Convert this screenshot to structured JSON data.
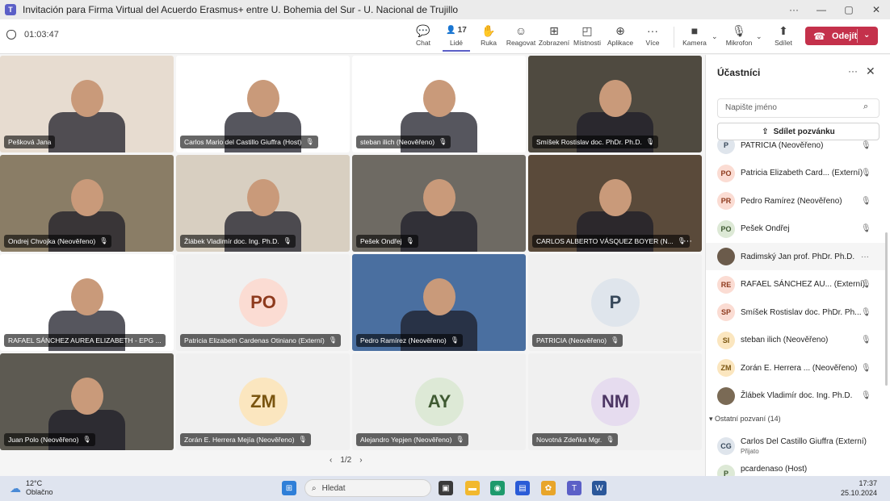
{
  "window": {
    "title": "Invitación para Firma Virtual del Acuerdo Erasmus+ entre U. Bohemia del Sur - U. Nacional de Trujillo",
    "app_icon": "T",
    "controls": [
      "···",
      "—",
      "▢",
      "✕"
    ]
  },
  "toolbar": {
    "timer": "01:03:47",
    "buttons": [
      {
        "label": "Chat",
        "icon": "chat-icon"
      },
      {
        "label": "Lidé",
        "icon": "people-icon",
        "count": "17"
      },
      {
        "label": "Ruka",
        "icon": "hand-icon"
      },
      {
        "label": "Reagovat",
        "icon": "emoji-icon"
      },
      {
        "label": "Zobrazení",
        "icon": "grid-icon"
      },
      {
        "label": "Místnosti",
        "icon": "rooms-icon"
      },
      {
        "label": "Aplikace",
        "icon": "plus-icon"
      },
      {
        "label": "Více",
        "icon": "more-icon"
      },
      {
        "label": "Kamera",
        "icon": "camera-icon"
      },
      {
        "label": "Mikrofon",
        "icon": "mic-icon"
      },
      {
        "label": "Sdílet",
        "icon": "share-icon"
      }
    ],
    "leave_label": "Odejít"
  },
  "tiles": [
    {
      "name": "Pešková Jana",
      "kind": "video",
      "bg": "#e7dcd0",
      "mic": false
    },
    {
      "name": "Carlos Mario del Castillo Giuffra (Host)",
      "kind": "video",
      "bg": "#ffffff",
      "mic": true
    },
    {
      "name": "steban ilich (Neověřeno)",
      "kind": "video",
      "bg": "#ffffff",
      "mic": true
    },
    {
      "name": "Smíšek Rostislav doc. PhDr. Ph.D.",
      "kind": "video",
      "bg": "#4f4a40",
      "mic": true
    },
    {
      "name": "Ondrej Chvojka (Neověřeno)",
      "kind": "video",
      "bg": "#8a7d66",
      "mic": true
    },
    {
      "name": "Žlábek Vladimír doc. Ing. Ph.D.",
      "kind": "video",
      "bg": "#d8cfc1",
      "mic": true
    },
    {
      "name": "Pešek Ondřej",
      "kind": "video",
      "bg": "#6e6a63",
      "mic": true
    },
    {
      "name": "CARLOS ALBERTO VÁSQUEZ BOYER (N...",
      "kind": "video",
      "bg": "#5a4a3a",
      "mic": true,
      "more": true
    },
    {
      "name": "RAFAEL SÁNCHEZ AUREA ELIZABETH - EPG ...",
      "kind": "video",
      "bg": "#ffffff",
      "mic": true
    },
    {
      "name": "Patricia Elizabeth Cardenas Otiniano (Externí)",
      "kind": "avatar",
      "initials": "PO",
      "av_bg": "#fbdcd3",
      "av_fg": "#8e3a1d",
      "mic": true
    },
    {
      "name": "Pedro Ramírez (Neověřeno)",
      "kind": "video",
      "bg": "#4a6fa0",
      "mic": true
    },
    {
      "name": "PATRICIA (Neověřeno)",
      "kind": "avatar",
      "initials": "P",
      "av_bg": "#dfe5ec",
      "av_fg": "#37485a",
      "mic": true
    },
    {
      "name": "Juan Polo (Neověřeno)",
      "kind": "video",
      "bg": "#5d5a52",
      "mic": true
    },
    {
      "name": "Zorán E. Herrera Mejía (Neověřeno)",
      "kind": "avatar",
      "initials": "ZM",
      "av_bg": "#fbe6bf",
      "av_fg": "#7a5510",
      "mic": true
    },
    {
      "name": "Alejandro Yepjen (Neověřeno)",
      "kind": "avatar",
      "initials": "AY",
      "av_bg": "#dde9d6",
      "av_fg": "#3f5a32",
      "mic": true
    },
    {
      "name": "Novotná Zdeňka Mgr.",
      "kind": "avatar",
      "initials": "NM",
      "av_bg": "#e6dcef",
      "av_fg": "#4d3664",
      "mic": true
    }
  ],
  "pager": {
    "prev": "‹",
    "label": "1/2",
    "next": "›"
  },
  "panel": {
    "title": "Účastníci",
    "search_placeholder": "Napište jméno",
    "share_label": "Sdílet pozvánku",
    "participants": [
      {
        "name": "PATRICIA (Neověřeno)",
        "initials": "P",
        "av_bg": "#dfe5ec",
        "av_fg": "#37485a",
        "status": "mute"
      },
      {
        "name": "Patricia Elizabeth Card... (Externí)",
        "initials": "PO",
        "av_bg": "#fbdcd3",
        "av_fg": "#8e3a1d",
        "status": "mute"
      },
      {
        "name": "Pedro Ramírez (Neověřeno)",
        "initials": "PR",
        "av_bg": "#fbdcd3",
        "av_fg": "#8e3a1d",
        "status": "mute"
      },
      {
        "name": "Pešek Ondřej",
        "initials": "PO",
        "av_bg": "#dde9d6",
        "av_fg": "#3f5a32",
        "status": "mute"
      },
      {
        "name": "Radimský Jan prof. PhDr. Ph.D.",
        "initials": "",
        "av_bg": "#6b5b4b",
        "av_fg": "#ffffff",
        "status": "more"
      },
      {
        "name": "RAFAEL SÁNCHEZ AU... (Externí)",
        "initials": "RE",
        "av_bg": "#fbdcd3",
        "av_fg": "#8e3a1d",
        "status": "mute"
      },
      {
        "name": "Smíšek Rostislav doc. PhDr. Ph...",
        "initials": "SP",
        "av_bg": "#fbdcd3",
        "av_fg": "#8e3a1d",
        "status": "mute"
      },
      {
        "name": "steban ilich (Neověřeno)",
        "initials": "SI",
        "av_bg": "#fbe6bf",
        "av_fg": "#7a5510",
        "status": "mute"
      },
      {
        "name": "Zorán E. Herrera ... (Neověřeno)",
        "initials": "ZM",
        "av_bg": "#fbe6bf",
        "av_fg": "#7a5510",
        "status": "mute"
      },
      {
        "name": "Žlábek Vladimír doc. Ing. Ph.D.",
        "initials": "",
        "av_bg": "#7a6a55",
        "av_fg": "#ffffff",
        "status": "mute"
      }
    ],
    "invited_section": "Ostatní pozvaní (14)",
    "invited": [
      {
        "name": "Carlos Del Castillo Giuffra (Externí)",
        "sub": "Přijato",
        "initials": "CG",
        "av_bg": "#dfe5ec",
        "av_fg": "#37485a"
      },
      {
        "name": "pcardenaso (Host)",
        "sub": "",
        "initials": "P",
        "av_bg": "#dde9d6",
        "av_fg": "#3f5a32"
      }
    ]
  },
  "taskbar": {
    "temp": "12°C",
    "weather": "Oblačno",
    "search_label": "Hledat",
    "time": "17:37",
    "date": "25.10.2024"
  }
}
